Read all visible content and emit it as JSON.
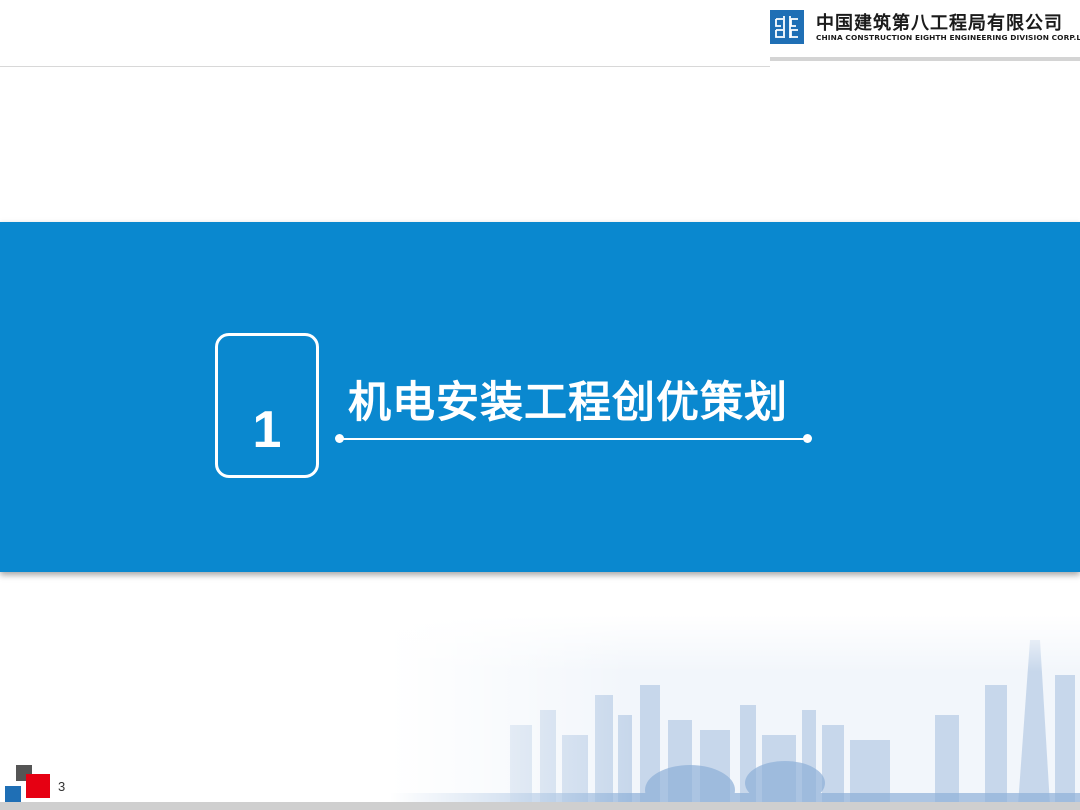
{
  "header": {
    "company_name_cn": "中国建筑第八工程局有限公司",
    "company_name_en": "CHINA CONSTRUCTION EIGHTH ENGINEERING DIVISION CORP.LTD",
    "logo_icon": "cscec-logo-icon",
    "brand_color": "#1f6fb5"
  },
  "section": {
    "number": "1",
    "title": "机电安装工程创优策划",
    "band_color": "#0a88cf"
  },
  "footer": {
    "page_number": "3",
    "corner_colors": [
      "#555555",
      "#e60012",
      "#1f6fb5"
    ]
  }
}
